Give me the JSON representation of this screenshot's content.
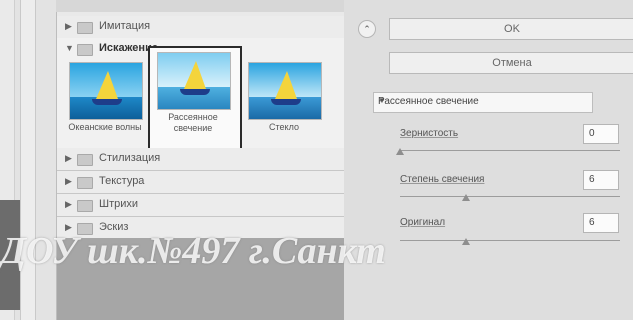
{
  "gallery": {
    "categories": [
      {
        "label": "Имитация",
        "expanded": false
      },
      {
        "label": "Искажение",
        "expanded": true
      },
      {
        "label": "Стилизация",
        "expanded": false
      },
      {
        "label": "Текстура",
        "expanded": false
      },
      {
        "label": "Штрихи",
        "expanded": false
      },
      {
        "label": "Эскиз",
        "expanded": false
      }
    ],
    "thumbnails": [
      {
        "label": "Океанские волны",
        "selected": false
      },
      {
        "label": "Рассеянное свечение",
        "selected": true
      },
      {
        "label": "Стекло",
        "selected": false
      }
    ]
  },
  "buttons": {
    "ok": "OK",
    "cancel": "Отмена"
  },
  "filter": {
    "selected": "Рассеянное свечение"
  },
  "params": [
    {
      "label": "Зернистость",
      "value": "0",
      "slider": 0.0
    },
    {
      "label": "Степень свечения",
      "value": "6",
      "slider": 0.3
    },
    {
      "label": "Оригинал",
      "value": "6",
      "slider": 0.3
    }
  ],
  "watermark": "ДОУ шк.№497 г.Санкт",
  "icons": {
    "collapse": "chevron-up-icon",
    "folder": "folder-icon",
    "expand": "triangle-right-icon",
    "select_arrow": "chevron-down-icon"
  }
}
